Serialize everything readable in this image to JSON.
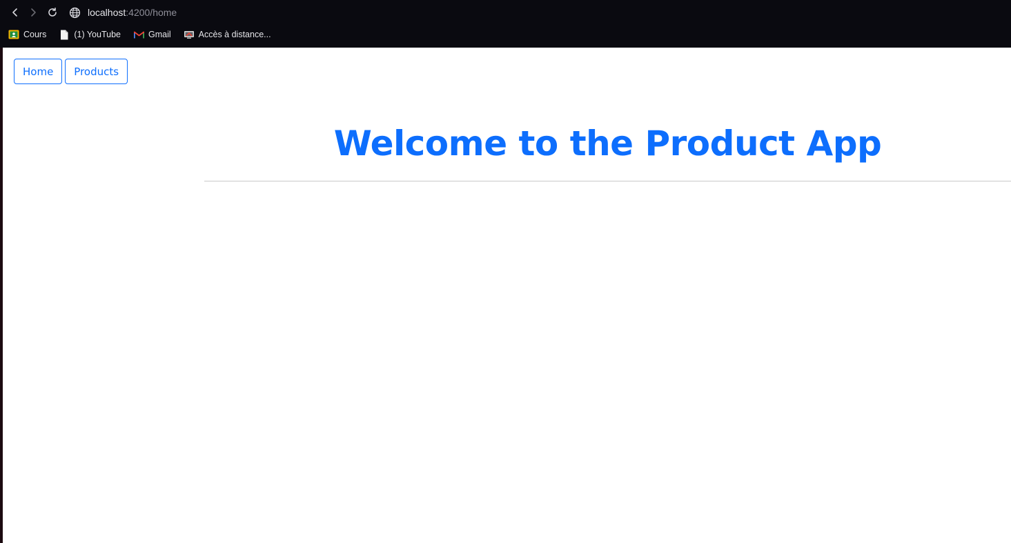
{
  "browser": {
    "url_host": "localhost",
    "url_path": ":4200/home",
    "bookmarks": [
      {
        "label": "Cours",
        "icon": "classroom-icon"
      },
      {
        "label": "(1) YouTube",
        "icon": "document-icon"
      },
      {
        "label": "Gmail",
        "icon": "gmail-icon"
      },
      {
        "label": "Accès à distance...",
        "icon": "remote-access-icon"
      }
    ]
  },
  "app": {
    "nav": {
      "home_label": "Home",
      "products_label": "Products"
    },
    "heading": "Welcome to the Product App",
    "colors": {
      "primary": "#0d6efd"
    }
  }
}
